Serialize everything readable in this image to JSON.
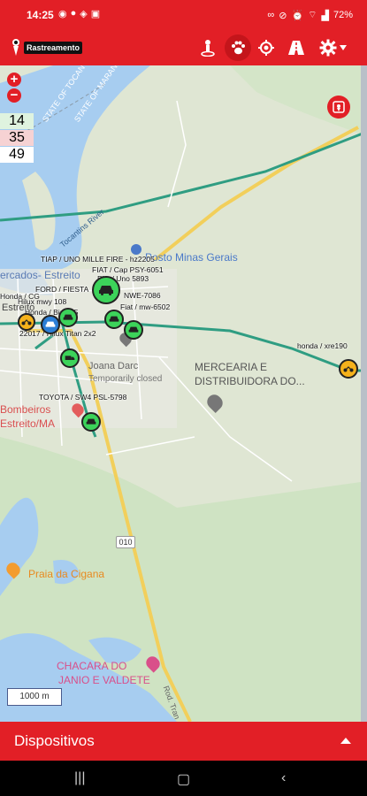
{
  "status": {
    "time": "14:25",
    "battery": "72%"
  },
  "app": {
    "logo_text": "Rastreamento"
  },
  "toolbar": {
    "icons": [
      "person-pin-icon",
      "paw-icon",
      "crosshair-icon",
      "road-icon",
      "gear-icon"
    ]
  },
  "map_controls": {
    "zoom_in": "+",
    "zoom_out": "−",
    "counts": [
      {
        "value": "14",
        "color": "#dff3df"
      },
      {
        "value": "35",
        "color": "#f6d2d3"
      },
      {
        "value": "49",
        "color": "#ffffff"
      }
    ],
    "scale": "1000 m"
  },
  "map_labels": {
    "state_tocantins": "STATE OF TOCAN",
    "state_maranhao": "STATE OF MARANH",
    "river": "Tocantins River",
    "posto": "Posto Minas Gerais",
    "mercados": "ercados- Estreito",
    "estreito": "Estreito",
    "joana": "Joana Darc",
    "temporarily": "Temporarily closed",
    "mercearia_1": "MERCEARIA E",
    "mercearia_2": "DISTRIBUIDORA DO...",
    "bombeiros_1": "Bombeiros",
    "bombeiros_2": "Estreito/MA",
    "road_010": "010",
    "praia": "Praia da Cigana",
    "chacara_1": "CHACARA DO",
    "chacara_2": "JANIO E VALDETE",
    "rod_tran": "Rod. Tran"
  },
  "vehicles": {
    "v1": "TIAP / UNO MILLE FIRE - hz2205",
    "v2": "FIAT / Cap PSY-6051",
    "v3": "Fiat / Uno 5893",
    "v4": "FORD / FIESTA",
    "v5": "NWE-7086",
    "v6": "Honda / Biz 125",
    "v7": "Fiat / mw-6502",
    "v8": "Honda / CG",
    "v9": "Hilux mwy 108",
    "v10": "22017 / Hilux Titan 2x2",
    "v11": "honda / xre190",
    "v12": "TOYOTA / SW4 PSL-5798"
  },
  "bottom_panel": {
    "title": "Dispositivos"
  }
}
